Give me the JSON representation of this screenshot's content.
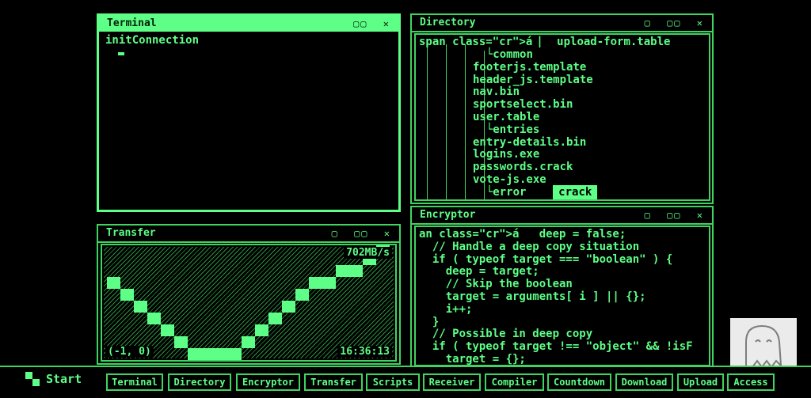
{
  "terminal": {
    "title": "Terminal",
    "controls": [
      "▢▢",
      "✕"
    ],
    "line1": "initConnection"
  },
  "directory": {
    "title": "Directory",
    "controls": [
      "▢",
      "▢▢",
      "✕"
    ],
    "first_line_prefix": "span class=\"cr\">á",
    "first_line_item": "upload-form.table",
    "items": [
      "common",
      "footerjs.template",
      "header_js.template",
      "nav.bin",
      "sportselect.bin",
      "user.table",
      "entries",
      "entry-details.bin",
      "logins.exe",
      "passwords.crack",
      "vote-js.exe",
      "error"
    ],
    "highlight": "crack"
  },
  "encryptor": {
    "title": "Encryptor",
    "controls": [
      "▢",
      "▢▢",
      "✕"
    ],
    "lines": [
      "an class=\"cr\">á   deep = false;",
      "  // Handle a deep copy situation",
      "  if ( typeof target === \"boolean\" ) {",
      "    deep = target;",
      "    // Skip the boolean",
      "    target = arguments[ i ] || {};",
      "    i++;",
      "  }",
      "  // Possible in deep copy",
      "  if ( typeof target !== \"object\" && !isF",
      "    target = {};"
    ]
  },
  "transfer": {
    "title": "Transfer",
    "controls": [
      "▢",
      "▢▢",
      "✕"
    ],
    "rate": "702MB/s",
    "coords": "(-1, 0)",
    "time": "16:36:13",
    "levels": [
      6,
      5,
      4,
      3,
      2,
      1,
      0,
      0,
      0,
      0,
      1,
      2,
      3,
      4,
      5,
      6,
      6,
      7,
      7,
      8,
      9
    ]
  },
  "taskbar": {
    "start_label": "Start",
    "buttons": [
      "Terminal",
      "Directory",
      "Encryptor",
      "Transfer",
      "Scripts",
      "Receiver",
      "Compiler",
      "Countdown",
      "Download",
      "Upload",
      "Access"
    ]
  }
}
